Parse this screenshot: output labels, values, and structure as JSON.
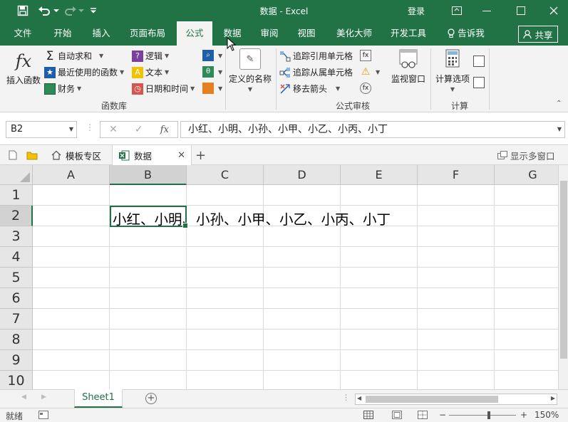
{
  "window": {
    "title": "数据  -  Excel",
    "login_label": "登录"
  },
  "ribbon_tabs": [
    "文件",
    "开始",
    "插入",
    "页面布局",
    "公式",
    "数据",
    "审阅",
    "视图",
    "美化大师",
    "开发工具"
  ],
  "active_tab": "公式",
  "tell_me": "告诉我",
  "share_label": "共享",
  "ribbon": {
    "function_library": {
      "group_label": "函数库",
      "insert_function": "插入函数",
      "autosum": "自动求和",
      "recently_used": "最近使用的函数",
      "financial": "财务",
      "logical": "逻辑",
      "text": "文本",
      "date_time": "日期和时间"
    },
    "defined_names": {
      "label": "定义的名称"
    },
    "formula_auditing": {
      "group_label": "公式审核",
      "trace_precedents": "追踪引用单元格",
      "trace_dependents": "追踪从属单元格",
      "remove_arrows": "移去箭头",
      "watch_window": "监视窗口"
    },
    "calculation": {
      "group_label": "计算",
      "calc_options": "计算选项"
    }
  },
  "formula_bar": {
    "name_box": "B2",
    "fx_label": "fx",
    "content": "小红、小明、小孙、小甲、小乙、小丙、小丁"
  },
  "doc_tabs": {
    "template_zone": "模板专区",
    "active_doc": "数据",
    "multi_window": "显示多窗口"
  },
  "grid": {
    "columns": [
      "A",
      "B",
      "C",
      "D",
      "E",
      "F",
      "G"
    ],
    "rows": [
      "1",
      "2",
      "3",
      "4",
      "5",
      "6",
      "7",
      "8",
      "9",
      "10"
    ],
    "selected_cell": "B2",
    "cells": {
      "B2": "小红、小明、小孙、小甲、小乙、小丙、小丁"
    }
  },
  "sheets": {
    "tabs": [
      "Sheet1"
    ],
    "active": "Sheet1"
  },
  "status": {
    "ready": "就绪",
    "zoom": "150%"
  },
  "colors": {
    "accent": "#217346",
    "ribbon_bg": "#f3f3f3",
    "header_bg": "#e6e6e6",
    "gridline": "#dadada"
  }
}
